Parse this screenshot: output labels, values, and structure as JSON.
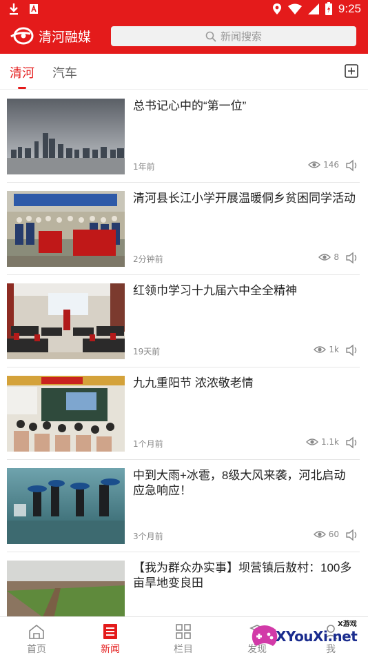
{
  "status_bar": {
    "time": "9:25",
    "icons": [
      "download-icon",
      "app-icon",
      "location-icon",
      "wifi-icon",
      "signal-icon",
      "battery-icon"
    ]
  },
  "header": {
    "brand_name": "清河融媒",
    "search_placeholder": "新闻搜索"
  },
  "tabs": [
    {
      "label": "清河",
      "active": true
    },
    {
      "label": "汽车",
      "active": false
    }
  ],
  "feed": [
    {
      "title": "总书记心中的“第一位”",
      "time": "1年前",
      "views": "146"
    },
    {
      "title": "清河县长江小学开展温暖侗乡贫困同学活动",
      "time": "2分钟前",
      "views": "8"
    },
    {
      "title": "红领巾学习十九届六中全全精神",
      "time": "19天前",
      "views": "1k"
    },
    {
      "title": "九九重阳节 浓浓敬老情",
      "time": "1个月前",
      "views": "1.1k"
    },
    {
      "title": "中到大雨+冰雹，8级大风来袭，河北启动应急响应！",
      "time": "3个月前",
      "views": "60"
    },
    {
      "title": "【我为群众办实事】坝营镇后敖村：100多亩旱地变良田",
      "time": "",
      "views": ""
    }
  ],
  "bottom_nav": [
    {
      "label": "首页",
      "icon": "home-icon",
      "active": false
    },
    {
      "label": "新闻",
      "icon": "news-icon",
      "active": true
    },
    {
      "label": "栏目",
      "icon": "grid-icon",
      "active": false
    },
    {
      "label": "发现",
      "icon": "discover-icon",
      "active": false
    },
    {
      "label": "我",
      "icon": "user-icon",
      "active": false
    }
  ],
  "watermark": {
    "text": "XYouXi.net",
    "sub": "X游戏"
  },
  "colors": {
    "accent": "#e41b1b"
  }
}
